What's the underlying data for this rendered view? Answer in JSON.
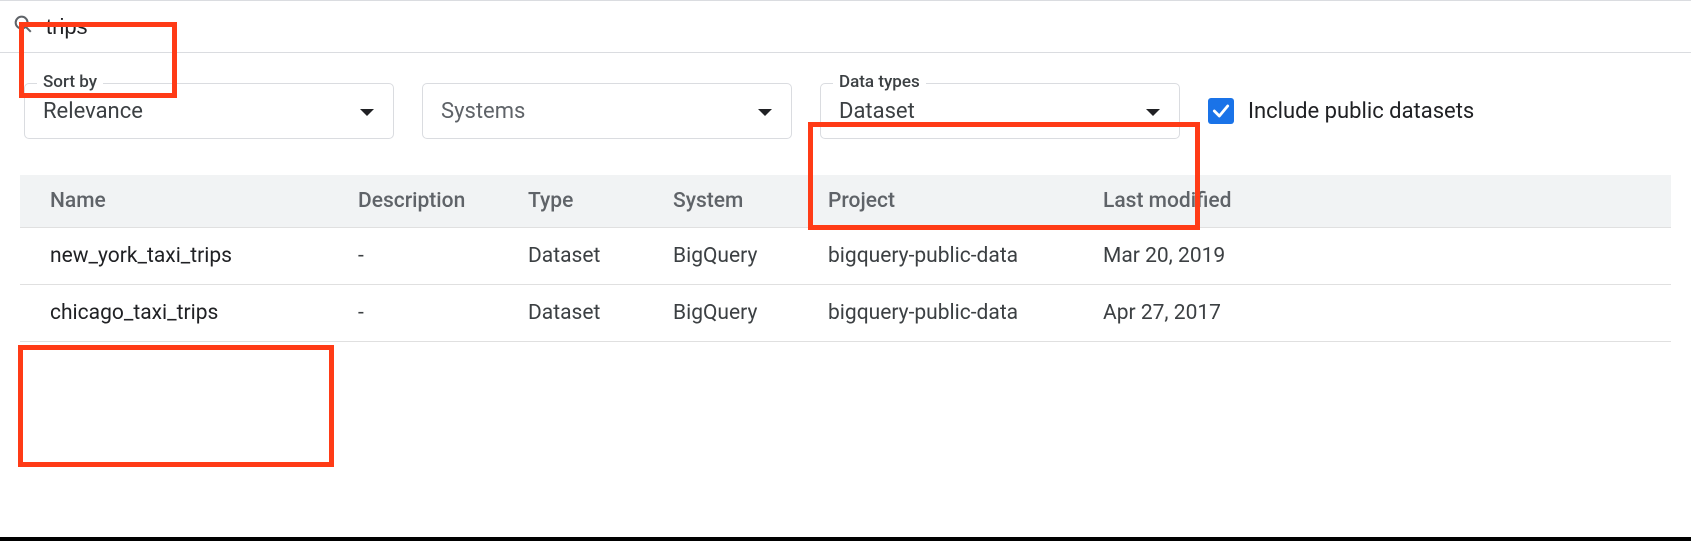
{
  "search": {
    "value": "trips"
  },
  "filters": {
    "sort_by": {
      "label": "Sort by",
      "value": "Relevance"
    },
    "systems": {
      "placeholder": "Systems"
    },
    "data_types": {
      "label": "Data types",
      "value": "Dataset"
    },
    "include_public": {
      "label": "Include public datasets",
      "checked": true
    }
  },
  "table": {
    "headers": {
      "name": "Name",
      "description": "Description",
      "type": "Type",
      "system": "System",
      "project": "Project",
      "last_modified": "Last modified"
    },
    "rows": [
      {
        "name": "new_york_taxi_trips",
        "description": "-",
        "type": "Dataset",
        "system": "BigQuery",
        "project": "bigquery-public-data",
        "last_modified": "Mar 20, 2019"
      },
      {
        "name": "chicago_taxi_trips",
        "description": "-",
        "type": "Dataset",
        "system": "BigQuery",
        "project": "bigquery-public-data",
        "last_modified": "Apr 27, 2017"
      }
    ]
  }
}
